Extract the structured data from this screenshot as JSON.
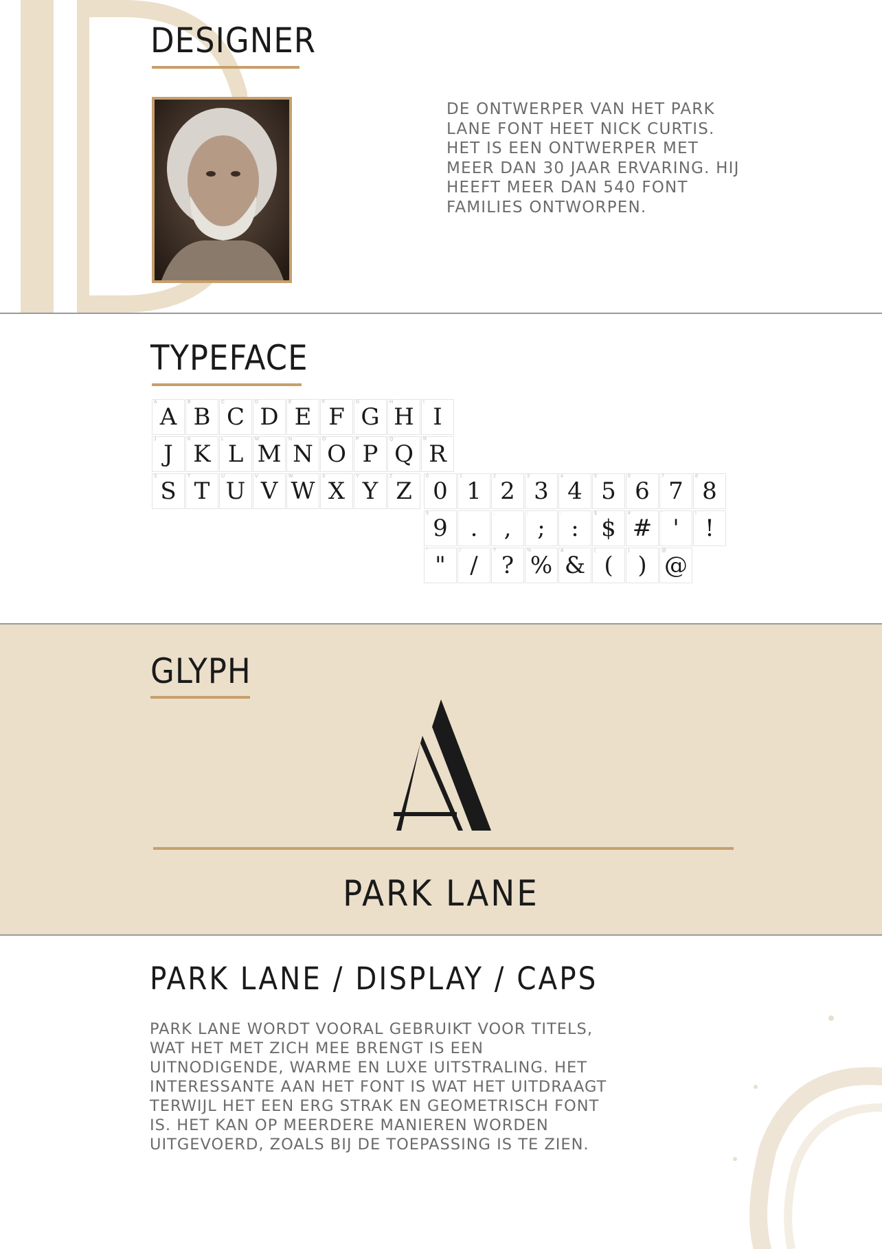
{
  "colors": {
    "accent_gold": "#c79f6c",
    "beige_band": "#ebdfca",
    "decor_letter": "#ebdfca",
    "text_dark": "#1a1a1a",
    "text_grey": "#6b6b6b",
    "separator": "#9a9a9a"
  },
  "designer": {
    "heading": "DESIGNER",
    "decor_letter": "D",
    "bio": "De ontwerper van het Park Lane font heet Nick Curtis. Het is een ontwerper met meer dan 30 jaar ervaring. Hij heeft meer dan 540 font families ontworpen."
  },
  "typeface": {
    "heading": "TYPEFACE",
    "rows": [
      [
        "A",
        "B",
        "C",
        "D",
        "E",
        "F",
        "G",
        "H",
        "I"
      ],
      [
        "J",
        "K",
        "L",
        "M",
        "N",
        "O",
        "P",
        "Q",
        "R"
      ],
      [
        "S",
        "T",
        "U",
        "V",
        "W",
        "X",
        "Y",
        "Z"
      ]
    ],
    "symbol_rows": [
      [
        "0",
        "1",
        "2",
        "3",
        "4",
        "5",
        "6",
        "7",
        "8"
      ],
      [
        "9",
        ".",
        ",",
        ";",
        ":",
        "$",
        "#",
        "'",
        "!"
      ],
      [
        "\"",
        "/",
        "?",
        "%",
        "&",
        "(",
        ")",
        "@"
      ]
    ]
  },
  "glyph": {
    "heading": "GLYPH",
    "letter": "A",
    "font_name": "PARK LANE"
  },
  "usage": {
    "heading": "PARK LANE / DISPLAY / CAPS",
    "body": "Park Lane wordt vooral gebruikt voor titels, wat het met zich mee brengt is een uitnodigende, warme en luxe uitstraling. Het interessante aan het font is wat het uitdraagt terwijl het een erg strak en geometrisch font is.  Het kan op meerdere manieren worden uitgevoerd, zoals bij de toepassing is te zien."
  }
}
